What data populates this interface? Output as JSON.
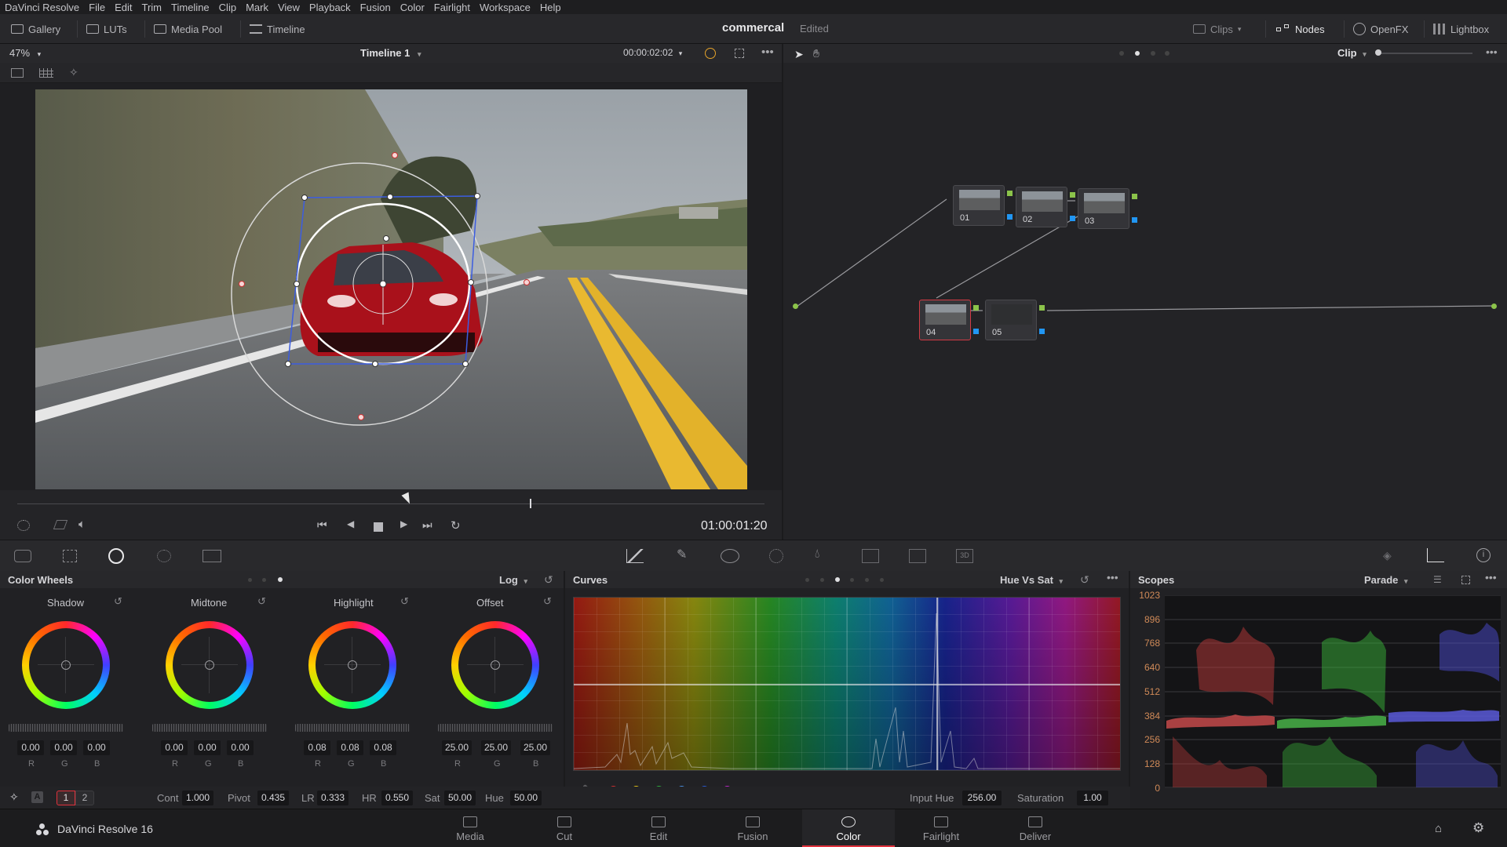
{
  "menubar": [
    "DaVinci Resolve",
    "File",
    "Edit",
    "Trim",
    "Timeline",
    "Clip",
    "Mark",
    "View",
    "Playback",
    "Fusion",
    "Color",
    "Fairlight",
    "Workspace",
    "Help"
  ],
  "toolbar": {
    "gallery": "Gallery",
    "luts": "LUTs",
    "media_pool": "Media Pool",
    "timeline": "Timeline",
    "project_title": "commercal",
    "project_status": "Edited",
    "clips": "Clips",
    "nodes": "Nodes",
    "openfx": "OpenFX",
    "lightbox": "Lightbox"
  },
  "viewer": {
    "zoom": "47%",
    "timeline_name": "Timeline 1",
    "source_timecode": "00:00:02:02",
    "record_timecode": "01:00:01:20"
  },
  "node_editor": {
    "mode": "Clip",
    "nodes": [
      {
        "label": "01"
      },
      {
        "label": "02"
      },
      {
        "label": "03"
      },
      {
        "label": "04"
      },
      {
        "label": "05"
      }
    ]
  },
  "color_wheels": {
    "title": "Color Wheels",
    "mode": "Log",
    "wheels": [
      {
        "name": "Shadow",
        "values": [
          "0.00",
          "0.00",
          "0.00"
        ]
      },
      {
        "name": "Midtone",
        "values": [
          "0.00",
          "0.00",
          "0.00"
        ]
      },
      {
        "name": "Highlight",
        "values": [
          "0.08",
          "0.08",
          "0.08"
        ]
      },
      {
        "name": "Offset",
        "values": [
          "25.00",
          "25.00",
          "25.00"
        ]
      }
    ],
    "channel_labels": [
      "R",
      "G",
      "B"
    ],
    "pages": [
      "1",
      "2"
    ],
    "params": [
      {
        "label": "Cont",
        "value": "1.000"
      },
      {
        "label": "Pivot",
        "value": "0.435"
      },
      {
        "label": "LR",
        "value": "0.333"
      },
      {
        "label": "HR",
        "value": "0.550"
      },
      {
        "label": "Sat",
        "value": "50.00"
      },
      {
        "label": "Hue",
        "value": "50.00"
      }
    ]
  },
  "curves": {
    "title": "Curves",
    "mode": "Hue Vs Sat",
    "input_hue_label": "Input Hue",
    "input_hue_value": "256.00",
    "saturation_label": "Saturation",
    "saturation_value": "1.00",
    "swatches": [
      "#d32f2f",
      "#e6c619",
      "#2eae3e",
      "#4a90e2",
      "#2a5bd7",
      "#c026c9"
    ]
  },
  "scopes": {
    "title": "Scopes",
    "mode": "Parade",
    "axis": [
      "1023",
      "896",
      "768",
      "640",
      "512",
      "384",
      "256",
      "128",
      "0"
    ]
  },
  "pagebar": {
    "app_name": "DaVinci Resolve 16",
    "pages": [
      "Media",
      "Cut",
      "Edit",
      "Fusion",
      "Color",
      "Fairlight",
      "Deliver"
    ],
    "active": "Color"
  }
}
